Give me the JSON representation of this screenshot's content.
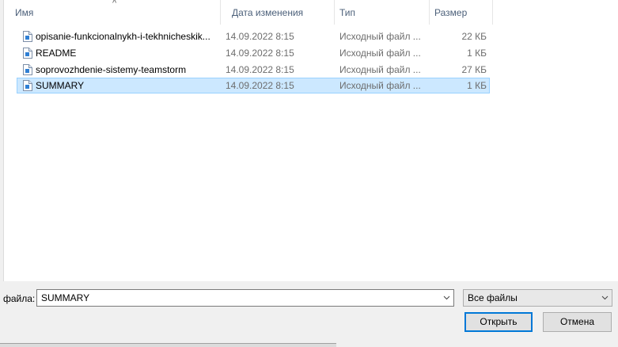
{
  "columns": {
    "name": "Имя",
    "date": "Дата изменения",
    "type": "Тип",
    "size": "Размер",
    "sort_arrow": "^"
  },
  "files": [
    {
      "name": "opisanie-funkcionalnykh-i-tekhnicheskik...",
      "date": "14.09.2022 8:15",
      "type": "Исходный файл ...",
      "size": "22 КБ"
    },
    {
      "name": "README",
      "date": "14.09.2022 8:15",
      "type": "Исходный файл ...",
      "size": "1 КБ"
    },
    {
      "name": "soprovozhdenie-sistemy-teamstorm",
      "date": "14.09.2022 8:15",
      "type": "Исходный файл ...",
      "size": "27 КБ"
    },
    {
      "name": "SUMMARY",
      "date": "14.09.2022 8:15",
      "type": "Исходный файл ...",
      "size": "1 КБ",
      "selected": true
    }
  ],
  "filename": {
    "label": "файла:",
    "value": "SUMMARY"
  },
  "filter": {
    "value": "Все файлы"
  },
  "buttons": {
    "open": "Открыть",
    "cancel": "Отмена"
  },
  "colors": {
    "selection_bg": "#cce8ff",
    "selection_border": "#99d1ff",
    "default_button_border": "#0078d7"
  }
}
